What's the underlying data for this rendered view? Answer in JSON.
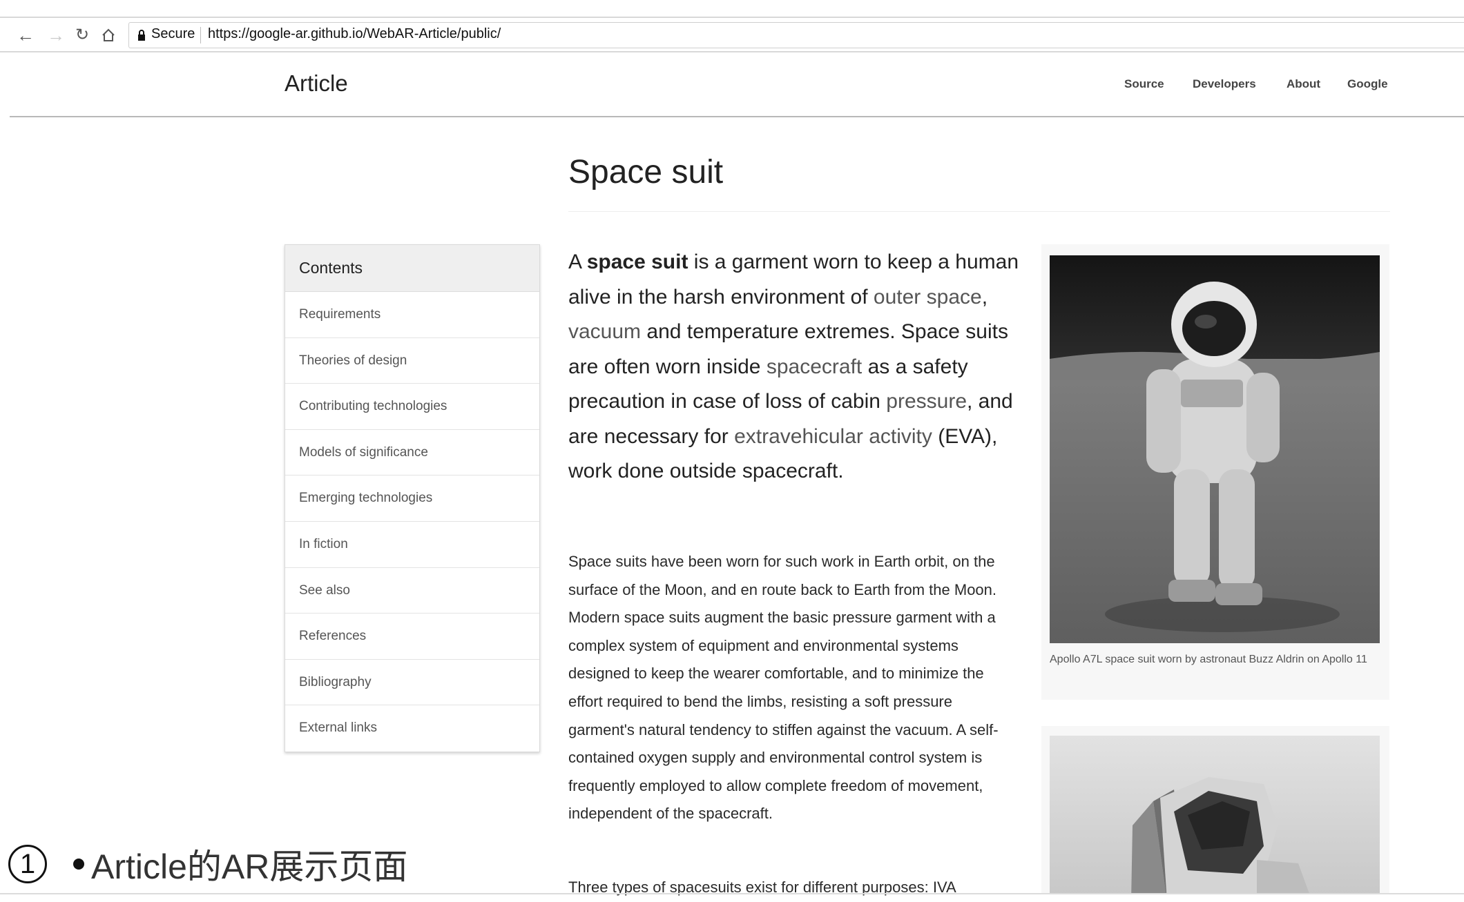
{
  "browser": {
    "back_icon": "back-arrow-icon",
    "secure_label": "Secure",
    "url": "https://google-ar.github.io/WebAR-Article/public/"
  },
  "header": {
    "brand": "Article",
    "nav": [
      "Source",
      "Developers",
      "About",
      "Google"
    ]
  },
  "article": {
    "title": "Space suit",
    "lead": {
      "prefix": "A ",
      "bold": "space suit",
      "rest_1": " is a garment worn to keep a human alive in the harsh environment of ",
      "link_outer_space": "outer space",
      "sep_1": ", ",
      "link_vacuum": "vacuum",
      "rest_2": " and temperature extremes. Space suits are often worn inside ",
      "link_spacecraft": "spacecraft",
      "rest_3": " as a safety precaution in case of loss of cabin ",
      "link_pressure": "pressure",
      "rest_4": ", and are necessary for ",
      "link_eva": "extravehicular activity",
      "rest_5": " (EVA), work done outside spacecraft."
    },
    "paragraph_1": "Space suits have been worn for such work in Earth orbit, on the surface of the Moon, and en route back to Earth from the Moon. Modern space suits augment the basic pressure garment with a complex system of equipment and environmental systems designed to keep the wearer comfortable, and to minimize the effort required to bend the limbs, resisting a soft pressure garment's natural tendency to stiffen against the vacuum. A self-contained oxygen supply and environmental control system is frequently employed to allow complete freedom of movement, independent of the spacecraft.",
    "paragraph_2": "Three types of spacesuits exist for different purposes: IVA"
  },
  "contents": {
    "heading": "Contents",
    "items": [
      "Requirements",
      "Theories of design",
      "Contributing technologies",
      "Models of significance",
      "Emerging technologies",
      "In fiction",
      "See also",
      "References",
      "Bibliography",
      "External links"
    ]
  },
  "figures": {
    "photo_caption": "Apollo A7L space suit worn by astronaut Buzz Aldrin on Apollo 11"
  },
  "annotation": {
    "number": "1",
    "text": "Article的AR展示页面"
  }
}
